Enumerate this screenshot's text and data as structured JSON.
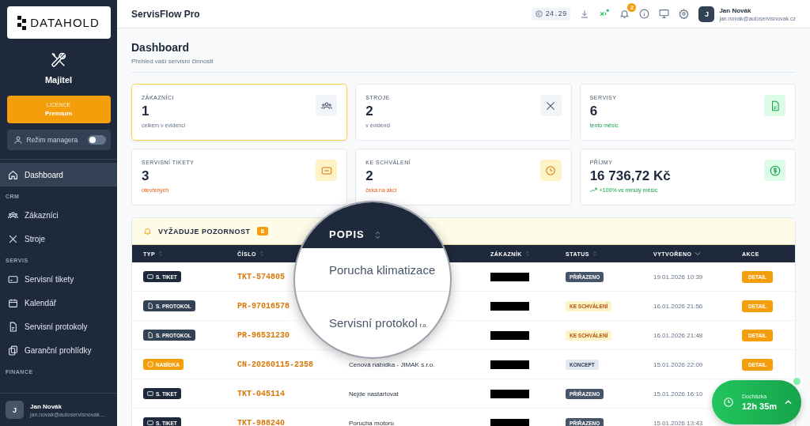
{
  "sidebar": {
    "logo": "DATAHOLD",
    "role": "Majitel",
    "licence": {
      "label": "LICENCE",
      "plan": "Premium"
    },
    "manager_mode": {
      "label": "Režim managera",
      "on": false
    },
    "nav": [
      {
        "kind": "item",
        "label": "Dashboard",
        "selected": true
      },
      {
        "kind": "section",
        "label": "CRM"
      },
      {
        "kind": "item",
        "label": "Zákazníci",
        "selected": false
      },
      {
        "kind": "item",
        "label": "Stroje",
        "selected": false
      },
      {
        "kind": "section",
        "label": "SERVIS"
      },
      {
        "kind": "item",
        "label": "Servisní tikety",
        "selected": false
      },
      {
        "kind": "item",
        "label": "Kalendář",
        "selected": false
      },
      {
        "kind": "item",
        "label": "Servisní protokoly",
        "selected": false
      },
      {
        "kind": "item",
        "label": "Garanční prohlídky",
        "selected": false
      },
      {
        "kind": "section",
        "label": "FINANCE"
      }
    ],
    "user": {
      "initial": "J",
      "name": "Jan Novák",
      "email": "jan.novak@autoservisnovak...."
    }
  },
  "header": {
    "title": "ServisFlow Pro",
    "credit": "24.29",
    "notifications": "2",
    "user": {
      "initial": "J",
      "name": "Jan Novák",
      "email": "jan.novak@autoservisnovak.cz"
    }
  },
  "page": {
    "title": "Dashboard",
    "subtitle": "Přehled vaší servisní činnosti"
  },
  "cards": [
    {
      "kind": "customers",
      "label": "ZÁKAZNÍCI",
      "value": "1",
      "sub": "celkem v evidenci",
      "highlighted": true
    },
    {
      "kind": "machines",
      "label": "STROJE",
      "value": "2",
      "sub": "v evidenci",
      "highlighted": false
    },
    {
      "kind": "services",
      "label": "SERVISY",
      "value": "6",
      "sub": "tento měsíc",
      "highlighted": false
    },
    {
      "kind": "tickets",
      "label": "SERVISNÍ TIKETY",
      "value": "3",
      "sub": "otevřených",
      "highlighted": false
    },
    {
      "kind": "approvals",
      "label": "KE SCHVÁLENÍ",
      "value": "2",
      "sub": "čeká na akci",
      "highlighted": false
    },
    {
      "kind": "income",
      "label": "PŘÍJMY",
      "value": "16 736,72 Kč",
      "sub": "+100% vs minulý měsíc",
      "highlighted": false
    }
  ],
  "attention": {
    "title": "VYŽADUJE POZORNOST",
    "count": "8",
    "columns": [
      "TYP",
      "ČÍSLO",
      "ZÁKAZNÍK",
      "STATUS",
      "VYTVOŘENO",
      "AKCE"
    ],
    "rows": [
      {
        "type": {
          "kind": "ticket",
          "label": "S. TIKET"
        },
        "number": "TKT-574805",
        "status": {
          "kind": "assigned",
          "label": "PŘIŘAZENO"
        },
        "created": "19.01.2026 10:39",
        "action": "DETAIL"
      },
      {
        "type": {
          "kind": "protocol",
          "label": "S. PROTOKOL"
        },
        "number": "PR-97016578",
        "status": {
          "kind": "approval",
          "label": "KE SCHVÁLENÍ"
        },
        "created": "16.01.2026 21:56",
        "action": "DETAIL"
      },
      {
        "type": {
          "kind": "protocol",
          "label": "S. PROTOKOL"
        },
        "number": "PR-96531230",
        "status": {
          "kind": "approval",
          "label": "KE SCHVÁLENÍ"
        },
        "created": "16.01.2026 21:48",
        "action": "DETAIL"
      },
      {
        "type": {
          "kind": "offer",
          "label": "NABÍDKA"
        },
        "number": "CN-20260115-2358",
        "description": "Cenová nabídka - JIMAK s.r.o.",
        "status": {
          "kind": "draft",
          "label": "KONCEPT"
        },
        "created": "15.01.2026 22:09",
        "action": "DETAIL"
      },
      {
        "type": {
          "kind": "ticket",
          "label": "S. TIKET"
        },
        "number": "TKT-045114",
        "description": "Nejde nastartovat",
        "status": {
          "kind": "assigned",
          "label": "PŘIŘAZENO"
        },
        "created": "15.01.2026 16:10"
      },
      {
        "type": {
          "kind": "ticket",
          "label": "S. TIKET"
        },
        "number": "TKT-988240",
        "description": "Porucha motoru",
        "status": {
          "kind": "assigned",
          "label": "PŘIŘAZENO"
        },
        "created": "15.01.2026 13:43"
      }
    ]
  },
  "magnifier": {
    "heading": "POPIS",
    "lines": [
      "Porucha klimatizace",
      "Servisní protokol"
    ],
    "fragment": "r.o."
  },
  "attendance": {
    "label": "Docházka",
    "time": "12h 35m"
  }
}
